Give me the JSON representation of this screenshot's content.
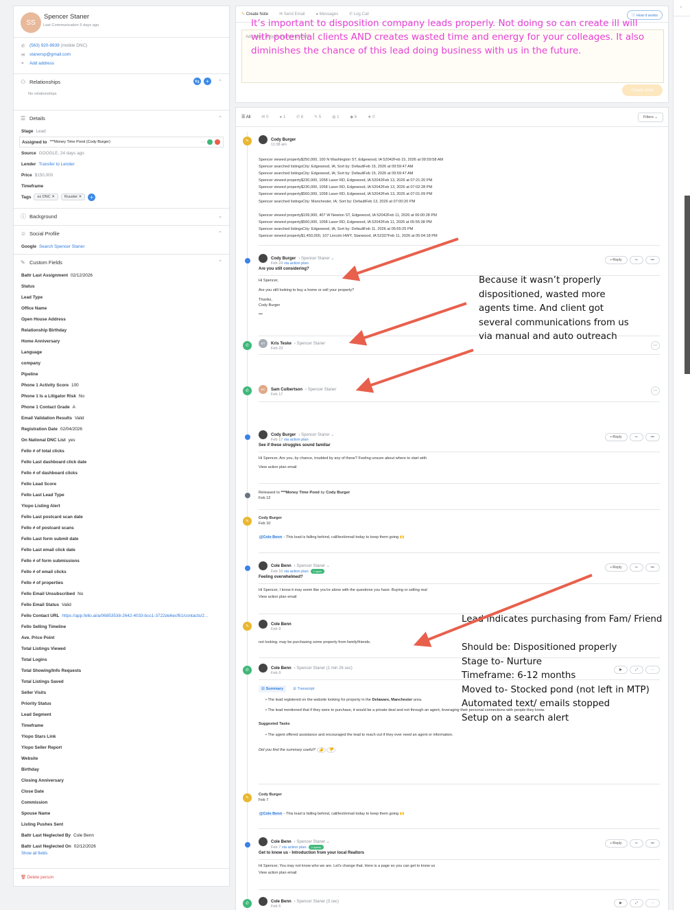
{
  "person": {
    "initials": "SS",
    "name": "Spencer Staner",
    "last_comm": "Last Communication 5 days ago",
    "phone": "(563) 920-8939",
    "phone_note": "(mobile DNC)",
    "email": "stanersp@gmail.com",
    "add_address": "Add address"
  },
  "relationships": {
    "title": "Relationships",
    "empty": "No relationships"
  },
  "details": {
    "title": "Details",
    "stage_label": "Stage",
    "stage": "Lead",
    "assigned_label": "Assigned to",
    "assigned": "***Money Time Pond (Cody Burger)",
    "source_label": "Source",
    "source": "GOOGLE, 24 days ago",
    "lender_label": "Lender",
    "lender": "Transfer to Lender",
    "price_label": "Price",
    "price": "$150,000",
    "timeframe_label": "Timeframe",
    "tags_label": "Tags",
    "tags": [
      "ez DNC",
      "Ruuster"
    ]
  },
  "background": {
    "title": "Background"
  },
  "social": {
    "title": "Social Profile",
    "google_label": "Google",
    "google": "Search Spencer Staner"
  },
  "custom": {
    "title": "Custom Fields",
    "fields": [
      [
        "Battr Last Assignment",
        "02/12/2026"
      ],
      [
        "Status",
        ""
      ],
      [
        "Lead Type",
        ""
      ],
      [
        "Office Name",
        ""
      ],
      [
        "Open House Address",
        ""
      ],
      [
        "Relationship Birthday",
        ""
      ],
      [
        "Home Anniversary",
        ""
      ],
      [
        "Language",
        ""
      ],
      [
        "company",
        ""
      ],
      [
        "Pipeline",
        ""
      ],
      [
        "Phone 1 Activity Score",
        "100"
      ],
      [
        "Phone 1 Is a Litigator Risk",
        "No"
      ],
      [
        "Phone 1 Contact Grade",
        "A"
      ],
      [
        "Email Validation Results",
        "Valid"
      ],
      [
        "Registration Date",
        "02/04/2026"
      ],
      [
        "On National DNC List",
        "yes"
      ],
      [
        "Fello # of total clicks",
        ""
      ],
      [
        "Fello Last dashboard click date",
        ""
      ],
      [
        "Fello # of dashboard clicks",
        ""
      ],
      [
        "Fello Lead Score",
        ""
      ],
      [
        "Fello Last Lead Type",
        ""
      ],
      [
        "Ylopo Listing Alert",
        ""
      ],
      [
        "Fello Last postcard scan date",
        ""
      ],
      [
        "Fello # of postcard scans",
        ""
      ],
      [
        "Fello Last form submit date",
        ""
      ],
      [
        "Fello Last email click date",
        ""
      ],
      [
        "Fello # of form submissions",
        ""
      ],
      [
        "Fello # of email clicks",
        ""
      ],
      [
        "Fello # of properties",
        ""
      ],
      [
        "Fello Email Unsubscribed",
        "No"
      ],
      [
        "Fello Email Status",
        "Valid"
      ],
      [
        "Fello Contact URL",
        "https://app.fello.ai/a/06853538-2642-4033-bcc1-3722de6ecf61/contacts/2..."
      ],
      [
        "Fello Selling Timeline",
        ""
      ],
      [
        "Ave. Price Point",
        ""
      ],
      [
        "Total Listings Viewed",
        ""
      ],
      [
        "Total Logins",
        ""
      ],
      [
        "Total Showing/Info Requests",
        ""
      ],
      [
        "Total Listings Saved",
        ""
      ],
      [
        "Seller Visits",
        ""
      ],
      [
        "Priority Status",
        ""
      ],
      [
        "Lead Segment",
        ""
      ],
      [
        "Timeframe",
        ""
      ],
      [
        "Ylopo Stars Link",
        ""
      ],
      [
        "Ylopo Seller Report",
        ""
      ],
      [
        "Website",
        ""
      ],
      [
        "Birthday",
        ""
      ],
      [
        "Closing Anniversary",
        ""
      ],
      [
        "Close Date",
        ""
      ],
      [
        "Commission",
        ""
      ],
      [
        "Spouse Name",
        ""
      ],
      [
        "Listing Pushes Sent",
        ""
      ],
      [
        "Battr Last Neglected By",
        "Cole Benn"
      ],
      [
        "Battr Last Neglected On",
        "02/12/2026"
      ]
    ],
    "show_all": "Show all fields"
  },
  "delete": "Delete person",
  "compose": {
    "tabs": [
      "Create Note",
      "Send Email",
      "Messages",
      "Log Call"
    ],
    "how": "How it works",
    "placeholder": "Add notes or type @name to notify",
    "create": "Create Note"
  },
  "annotation_top": "It’s important to disposition company leads properly.  Not doing so can create ill will with potential clients AND creates wasted time and energy for your colleages.  It also diminishes the chance of this lead doing business with us in the future.",
  "annotation_mid": [
    "Because it wasn’t properly",
    "dispositioned, wasted more",
    "agents time.  And client got",
    "several communications from us",
    "via manual and auto outreach"
  ],
  "annotation_low": [
    "Lead indicates purchasing from Fam/ Friend",
    "",
    "Should be: Dispositioned properly",
    "Stage to- Nurture",
    "Timeframe: 6-12 months",
    "Moved to- Stocked pond (not left in MTP)",
    "Automated text/ emails stopped",
    "Setup on a search alert"
  ],
  "filter_tabs": [
    "All",
    "0",
    "1",
    "6",
    "5",
    "1",
    "6",
    "0"
  ],
  "filters": "Filters",
  "activity": {
    "name": "Cody Burger",
    "time": "11:38 am",
    "lines": [
      "Spencer viewed property$250,000, 100 N Washington ST, Edgewood, IA 52042Feb 15, 2026 at 09:59:58 AM",
      "Spencer searched listingsCity: Edgewood, IA; Sort by: DefaultFeb 15, 2026 at 09:59:47 AM",
      "Spencer searched listingsCity: Edgewood, IA; Sort by: DefaultFeb 15, 2026 at 09:59:47 AM",
      "Spencer viewed property$230,000, 1058 Laser RD, Edgewood, IA 52042Feb 13, 2026 at 07:21:20 PM",
      "Spencer viewed property$230,000, 1058 Laser RD, Edgewood, IA 52042Feb 13, 2026 at 07:02:28 PM",
      "Spencer viewed property$560,000, 1058 Laser RD, Edgewood, IA 52042Feb 13, 2026 at 07:01:09 PM",
      "Spencer searched listingsCity: Manchester, IA; Sort by: DefaultFeb 13, 2026 at 07:00:20 PM",
      "",
      "Spencer viewed property$199,900, 407 W Newton ST, Edgewood, IA 52042Feb 11, 2026 at 06:00:28 PM",
      "Spencer viewed property$560,000, 1058 Laser RD, Edgewood, IA 52042Feb 11, 2026 at 05:55:38 PM",
      "Spencer searched listingsCity: Edgewood, IA; Sort by: DefaultFeb 11, 2026 at 05:55:25 PM",
      "Spencer viewed property$1,450,000, 107 Lincoln HWY, Stanwood, IA 52337Feb 11, 2026 at 05:04:18 PM"
    ]
  },
  "e1": {
    "name": "Cody Burger",
    "to": "Spencer Staner",
    "date": "Feb 24",
    "via": "via action plan",
    "subject": "Are you still considering?",
    "body": [
      "Hi Spencer,",
      "",
      "Are you still looking to buy a home or sell your property?",
      "",
      "Thanks,",
      "Cody Burger"
    ],
    "reply": "Reply"
  },
  "e2": {
    "initials": "KT",
    "name": "Kris Teske",
    "to": "Spencer Staner",
    "date": "Feb 23"
  },
  "e3": {
    "initials": "SC",
    "name": "Sam Culbertson",
    "to": "Spencer Staner",
    "date": "Feb 17"
  },
  "e4": {
    "name": "Cody Burger",
    "to": "Spencer Staner",
    "date": "Feb 17",
    "via": "via action plan",
    "subject": "See if these struggles sound familiar",
    "body": "Hi Spencer, Are you, by chance, troubled by any of these? Feeling unsure about where to start with",
    "view": "View action plan email",
    "reply": "Reply"
  },
  "e5": {
    "pre": "Released to",
    "pond": "***Money Time Pond",
    "by": "by",
    "name": "Cody Burger",
    "date": "Feb 12"
  },
  "e6": {
    "name": "Cody Burger",
    "date": "Feb 10",
    "mention": "@Cole Benn",
    "text": " - This lead is falling behind, call/text/email today to keep them going 🙌"
  },
  "e7": {
    "name": "Cole Benn",
    "to": "Spencer Staner",
    "date": "Feb 10",
    "via": "via action plan",
    "pill": "1 open",
    "subject": "Feeling overwhelmed?",
    "body": "Hi Spencer, I know it may seem like you're alone with the questions you have. Buying or selling real",
    "view": "View action plan email",
    "reply": "Reply"
  },
  "e8": {
    "name": "Cole Benn",
    "date": "Feb 9",
    "text": "not looking. may be purchasing some property from family/friends."
  },
  "e9": {
    "name": "Cole Benn",
    "to": "Spencer Staner",
    "dur": "(1 min 26 sec)",
    "date": "Feb 9",
    "tab1": "Summary",
    "tab2": "Transcript",
    "b1a": "The lead registered on the website looking for property in the ",
    "b1b": "Delaware, Manchester",
    "b1c": " area.",
    "b2": "The lead mentioned that if they were to purchase, it would be a private deal and not through an agent, leveraging their personal connections with people they know.",
    "tasks": "Suggested Tasks",
    "t1": "The agent offered assistance and encouraged the lead to reach out if they ever need an agent or information.",
    "useful": "Did you find the summary useful?"
  },
  "e10": {
    "name": "Cody Burger",
    "date": "Feb 7",
    "mention": "@Cole Benn",
    "text": " - This lead is falling behind, call/text/email today to keep them going 🙌"
  },
  "e11": {
    "name": "Cole Benn",
    "to": "Spencer Staner",
    "date": "Feb 7",
    "via": "via action plan",
    "pill": "2 opens",
    "subject": "Get to know us - Introduction from your local Realtors",
    "body": "Hi Spencer, You may not know who we are. Let's change that. Here is a page so you can get to know us",
    "view": "View action plan email",
    "reply": "Reply"
  },
  "e12": {
    "name": "Cole Benn",
    "to": "Spencer Staner",
    "dur": "(3 sec)",
    "date": "Feb 6"
  },
  "colors": {
    "annotation_magenta": "#e63fd4",
    "arrow": "#e8604c",
    "link": "#2f7bd9"
  }
}
